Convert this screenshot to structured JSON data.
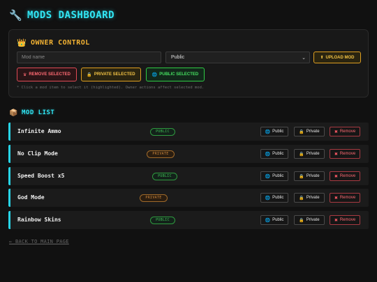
{
  "header": {
    "icon": "wrench-icon",
    "title": "MODS DASHBOARD"
  },
  "owner": {
    "icon": "crown-icon",
    "title": "OWNER CONTROL",
    "name_input": {
      "placeholder": "Mod name",
      "value": ""
    },
    "visibility_select": {
      "selected": "Public"
    },
    "upload_button": {
      "label": "UPLOAD MOD",
      "icon": "upload-icon"
    },
    "remove_selected_button": {
      "label": "REMOVE SELECTED",
      "icon": "crown-icon"
    },
    "private_selected_button": {
      "label": "PRIVATE SELECTED",
      "icon": "lock-icon"
    },
    "public_selected_button": {
      "label": "PUBLIC SELECTED",
      "icon": "globe-icon"
    },
    "hint": "* Click a mod item to select it (highlighted). Owner actions affect selected mod."
  },
  "mod_list": {
    "icon": "package-icon",
    "title": "MOD LIST",
    "actions": {
      "public": "Public",
      "private": "Private",
      "remove": "Remove"
    },
    "items": [
      {
        "name": "Infinite Ammo",
        "status": "PUBLIC"
      },
      {
        "name": "No Clip Mode",
        "status": "PRIVATE"
      },
      {
        "name": "Speed Boost x5",
        "status": "PUBLIC"
      },
      {
        "name": "God Mode",
        "status": "PRIVATE"
      },
      {
        "name": "Rainbow Skins",
        "status": "PUBLIC"
      }
    ]
  },
  "footer": {
    "back_link": "← BACK TO MAIN PAGE"
  },
  "colors": {
    "background": "#111111",
    "accent_cyan": "#31e7f5",
    "accent_gold": "#f2b233",
    "danger": "#ff6a73",
    "success": "#45e060"
  }
}
